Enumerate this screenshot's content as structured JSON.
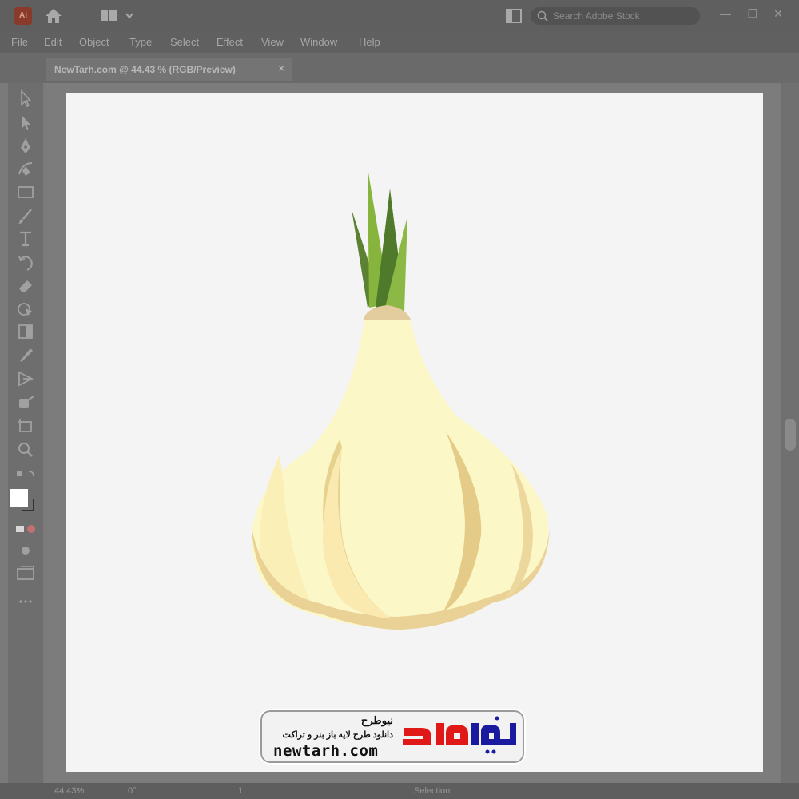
{
  "app": {
    "logo_text": "Ai"
  },
  "search": {
    "placeholder": "Search Adobe Stock"
  },
  "menu": [
    "File",
    "Edit",
    "Object",
    "Type",
    "Select",
    "Effect",
    "View",
    "Window",
    "Help"
  ],
  "document_tab": {
    "label": "NewTarh.com @ 44.43 % (RGB/Preview)",
    "close": "×"
  },
  "window_controls": {
    "minimize": "—",
    "restore": "❐",
    "close": "✕"
  },
  "tools": [
    "selection-tool-icon",
    "direct-selection-tool-icon",
    "pen-tool-icon",
    "curvature-tool-icon",
    "rectangle-tool-icon",
    "paintbrush-tool-icon",
    "type-tool-icon",
    "rotate-tool-icon",
    "eraser-tool-icon",
    "shape-builder-tool-icon",
    "gradient-tool-icon",
    "eyedropper-tool-icon",
    "blend-tool-icon",
    "symbol-sprayer-tool-icon",
    "artboard-tool-icon",
    "zoom-tool-icon"
  ],
  "status": {
    "zoom": "44.43%",
    "rotation": "0°",
    "artboard": "1",
    "mode": "Selection"
  },
  "colors": {
    "fill": "#ffffff",
    "stroke": "#333333"
  },
  "watermark": {
    "title": "نیوطرح",
    "subtitle": "دانلود طرح لایه باز بنر و تراکت",
    "url": "newtarh.com",
    "logo_text": "نیوطرح"
  }
}
